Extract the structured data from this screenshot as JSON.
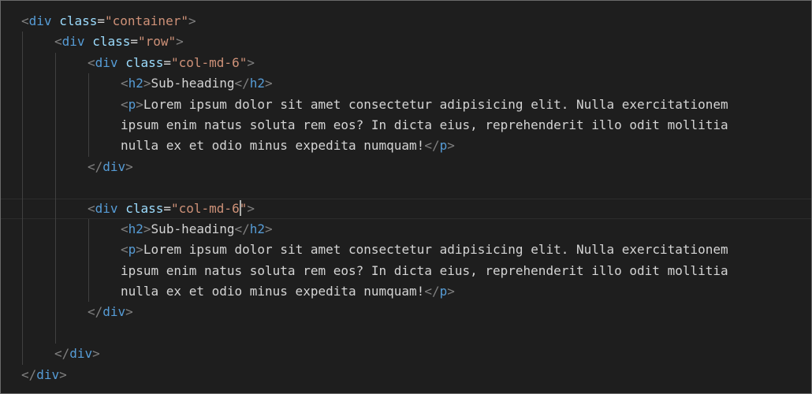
{
  "editor": {
    "lines": [
      {
        "indent": 0,
        "tokens": [
          [
            "punc",
            "<"
          ],
          [
            "tag",
            "div"
          ],
          [
            "txt",
            " "
          ],
          [
            "attr",
            "class"
          ],
          [
            "eq",
            "="
          ],
          [
            "str",
            "\"container\""
          ],
          [
            "punc",
            ">"
          ]
        ]
      },
      {
        "indent": 1,
        "tokens": [
          [
            "punc",
            "<"
          ],
          [
            "tag",
            "div"
          ],
          [
            "txt",
            " "
          ],
          [
            "attr",
            "class"
          ],
          [
            "eq",
            "="
          ],
          [
            "str",
            "\"row\""
          ],
          [
            "punc",
            ">"
          ]
        ]
      },
      {
        "indent": 2,
        "tokens": [
          [
            "punc",
            "<"
          ],
          [
            "tag",
            "div"
          ],
          [
            "txt",
            " "
          ],
          [
            "attr",
            "class"
          ],
          [
            "eq",
            "="
          ],
          [
            "str",
            "\"col-md-6\""
          ],
          [
            "punc",
            ">"
          ]
        ]
      },
      {
        "indent": 3,
        "tokens": [
          [
            "punc",
            "<"
          ],
          [
            "tag",
            "h2"
          ],
          [
            "punc",
            ">"
          ],
          [
            "txt",
            "Sub-heading"
          ],
          [
            "punc",
            "</"
          ],
          [
            "tag",
            "h2"
          ],
          [
            "punc",
            ">"
          ]
        ]
      },
      {
        "indent": 3,
        "tokens": [
          [
            "punc",
            "<"
          ],
          [
            "tag",
            "p"
          ],
          [
            "punc",
            ">"
          ],
          [
            "txt",
            "Lorem ipsum dolor sit amet consectetur adipisicing elit. Nulla exercitationem"
          ]
        ]
      },
      {
        "indent": 3,
        "tokens": [
          [
            "txt",
            "ipsum enim natus soluta rem eos? In dicta eius, reprehenderit illo odit mollitia"
          ]
        ]
      },
      {
        "indent": 3,
        "tokens": [
          [
            "txt",
            "nulla ex et odio minus expedita numquam!"
          ],
          [
            "punc",
            "</"
          ],
          [
            "tag",
            "p"
          ],
          [
            "punc",
            ">"
          ]
        ]
      },
      {
        "indent": 2,
        "tokens": [
          [
            "punc",
            "</"
          ],
          [
            "tag",
            "div"
          ],
          [
            "punc",
            ">"
          ]
        ]
      },
      {
        "indent": 0,
        "tokens": []
      },
      {
        "indent": 2,
        "current": true,
        "tokens": [
          [
            "punc",
            "<"
          ],
          [
            "tag",
            "div"
          ],
          [
            "txt",
            " "
          ],
          [
            "attr",
            "class"
          ],
          [
            "eq",
            "="
          ],
          [
            "str",
            "\"col-md-6"
          ],
          [
            "cursor",
            ""
          ],
          [
            "str",
            "\""
          ],
          [
            "punc",
            ">"
          ]
        ]
      },
      {
        "indent": 3,
        "tokens": [
          [
            "punc",
            "<"
          ],
          [
            "tag",
            "h2"
          ],
          [
            "punc",
            ">"
          ],
          [
            "txt",
            "Sub-heading"
          ],
          [
            "punc",
            "</"
          ],
          [
            "tag",
            "h2"
          ],
          [
            "punc",
            ">"
          ]
        ]
      },
      {
        "indent": 3,
        "tokens": [
          [
            "punc",
            "<"
          ],
          [
            "tag",
            "p"
          ],
          [
            "punc",
            ">"
          ],
          [
            "txt",
            "Lorem ipsum dolor sit amet consectetur adipisicing elit. Nulla exercitationem"
          ]
        ]
      },
      {
        "indent": 3,
        "tokens": [
          [
            "txt",
            "ipsum enim natus soluta rem eos? In dicta eius, reprehenderit illo odit mollitia"
          ]
        ]
      },
      {
        "indent": 3,
        "tokens": [
          [
            "txt",
            "nulla ex et odio minus expedita numquam!"
          ],
          [
            "punc",
            "</"
          ],
          [
            "tag",
            "p"
          ],
          [
            "punc",
            ">"
          ]
        ]
      },
      {
        "indent": 2,
        "tokens": [
          [
            "punc",
            "</"
          ],
          [
            "tag",
            "div"
          ],
          [
            "punc",
            ">"
          ]
        ]
      },
      {
        "indent": 0,
        "tokens": []
      },
      {
        "indent": 1,
        "tokens": [
          [
            "punc",
            "</"
          ],
          [
            "tag",
            "div"
          ],
          [
            "punc",
            ">"
          ]
        ]
      },
      {
        "indent": 0,
        "tokens": [
          [
            "punc",
            "</"
          ],
          [
            "tag",
            "div"
          ],
          [
            "punc",
            ">"
          ]
        ]
      }
    ],
    "guides_per_line": [
      0,
      1,
      2,
      3,
      3,
      3,
      3,
      2,
      2,
      2,
      3,
      3,
      3,
      3,
      2,
      2,
      1,
      0
    ],
    "colors": {
      "background": "#1e1e1e",
      "punctuation": "#808080",
      "tag": "#569cd6",
      "attribute": "#9cdcfe",
      "string": "#ce9178",
      "text": "#d4d4d4",
      "indent_guide": "#404040"
    }
  }
}
